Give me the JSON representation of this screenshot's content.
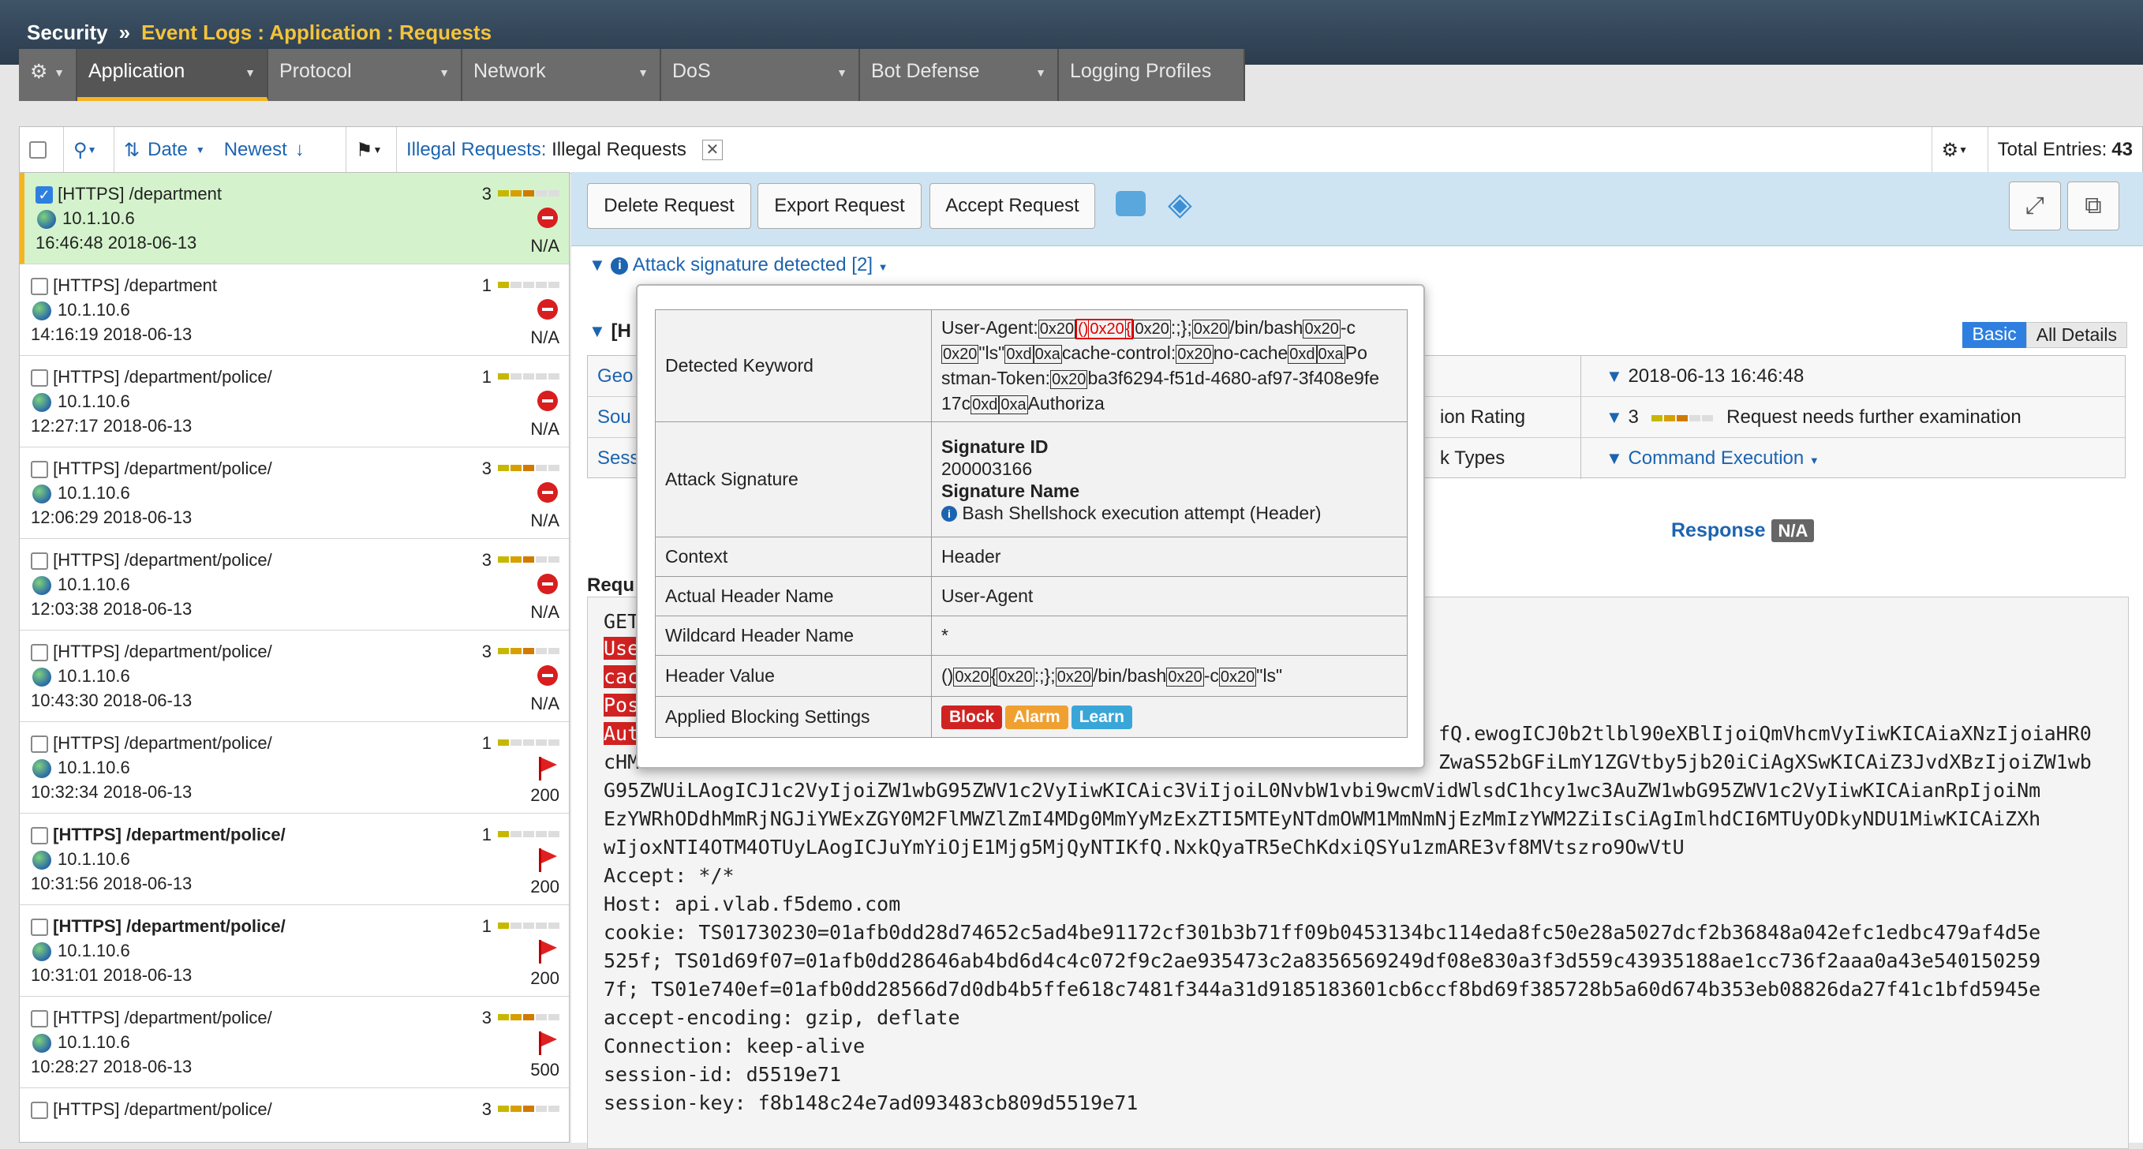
{
  "breadcrumb": {
    "root": "Security",
    "separator": "»",
    "path": "Event Logs : Application : Requests"
  },
  "tabs": [
    {
      "label": "Application"
    },
    {
      "label": "Protocol"
    },
    {
      "label": "Network"
    },
    {
      "label": "DoS"
    },
    {
      "label": "Bot Defense"
    },
    {
      "label": "Logging Profiles"
    }
  ],
  "toolbar": {
    "sort_label": "Date",
    "order_label": "Newest",
    "filter_key": "Illegal Requests:",
    "filter_value": "Illegal Requests",
    "total_label": "Total Entries:",
    "total_value": "43"
  },
  "colors": {
    "accent": "#f3b524",
    "link": "#1c64b0",
    "selected_row": "#d4f3cc",
    "block": "#d12222",
    "alarm": "#f0a030",
    "learn": "#3aa6d8"
  },
  "requests": [
    {
      "url": "[HTTPS] /department",
      "ip": "10.1.10.6",
      "time": "16:46:48 2018-06-13",
      "rating": "3",
      "code": "N/A",
      "status": "blocked",
      "selected": true,
      "bold": false
    },
    {
      "url": "[HTTPS] /department",
      "ip": "10.1.10.6",
      "time": "14:16:19 2018-06-13",
      "rating": "1",
      "code": "N/A",
      "status": "blocked",
      "selected": false,
      "bold": false
    },
    {
      "url": "[HTTPS] /department/police/",
      "ip": "10.1.10.6",
      "time": "12:27:17 2018-06-13",
      "rating": "1",
      "code": "N/A",
      "status": "blocked",
      "selected": false,
      "bold": false
    },
    {
      "url": "[HTTPS] /department/police/",
      "ip": "10.1.10.6",
      "time": "12:06:29 2018-06-13",
      "rating": "3",
      "code": "N/A",
      "status": "blocked",
      "selected": false,
      "bold": false
    },
    {
      "url": "[HTTPS] /department/police/",
      "ip": "10.1.10.6",
      "time": "12:03:38 2018-06-13",
      "rating": "3",
      "code": "N/A",
      "status": "blocked",
      "selected": false,
      "bold": false
    },
    {
      "url": "[HTTPS] /department/police/",
      "ip": "10.1.10.6",
      "time": "10:43:30 2018-06-13",
      "rating": "3",
      "code": "N/A",
      "status": "blocked",
      "selected": false,
      "bold": false
    },
    {
      "url": "[HTTPS] /department/police/",
      "ip": "10.1.10.6",
      "time": "10:32:34 2018-06-13",
      "rating": "1",
      "code": "200",
      "status": "flagged",
      "selected": false,
      "bold": false
    },
    {
      "url": "[HTTPS] /department/police/",
      "ip": "10.1.10.6",
      "time": "10:31:56 2018-06-13",
      "rating": "1",
      "code": "200",
      "status": "flagged",
      "selected": false,
      "bold": true
    },
    {
      "url": "[HTTPS] /department/police/",
      "ip": "10.1.10.6",
      "time": "10:31:01 2018-06-13",
      "rating": "1",
      "code": "200",
      "status": "flagged",
      "selected": false,
      "bold": true
    },
    {
      "url": "[HTTPS] /department/police/",
      "ip": "10.1.10.6",
      "time": "10:28:27 2018-06-13",
      "rating": "3",
      "code": "500",
      "status": "flagged",
      "selected": false,
      "bold": false
    },
    {
      "url": "[HTTPS] /department/police/",
      "ip": "",
      "time": "",
      "rating": "3",
      "code": "",
      "status": "",
      "selected": false,
      "bold": false
    }
  ],
  "actions": {
    "delete": "Delete Request",
    "export": "Export Request",
    "accept": "Accept Request"
  },
  "attack_line": "Attack signature detected [2]",
  "view_toggle": {
    "basic": "Basic",
    "all": "All Details"
  },
  "details": {
    "left_labels": [
      "Geo",
      "Sou",
      "Sess"
    ],
    "prefix_partial": "[H",
    "mid_labels": [
      "",
      "ion Rating",
      "k Types"
    ],
    "date": "2018-06-13 16:46:48",
    "rating_value": "3",
    "rating_text": "Request needs further examination",
    "attack_type": "Command Execution"
  },
  "response": {
    "label": "Response",
    "value": "N/A"
  },
  "request_label": "Requ",
  "raw_request": {
    "line_get": "GET",
    "red_tags": [
      "Use",
      "cac",
      "Pos",
      "Aut"
    ],
    "token_tail": "fQ.ewogICJ0b2tlbl90eXBlIjoiQmVhcmVyIiwKICAiaXNzIjoiaHR0",
    "lines": [
      "cHM",
      "G95ZWUiLAogICJ1c2VyIjoiZW1wbG95ZWV1c2VyIiwKICAic3ViIjoiL0NvbW1vbi9wcmVidWlsdC1hcy1wc3AuZW1wbG95ZWV1c2VyIiwKICAianRpIjoiNm",
      "EzYWRhODdhMmRjNGJiYWExZGY0M2FlMWZlZmI4MDg0MmYyMzExZTI5MTEyNTdmOWM1MmNmNjEzMmIzYWM2ZiIsCiAgImlhdCI6MTUyODkyNDU1MiwKICAiZXh",
      "wIjoxNTI4OTM4OTUyLAogICJuYmYiOjE1Mjg5MjQyNTIKfQ.NxkQyaTR5eChKdxiQSYu1zmARE3vf8MVtszro9OwVtU",
      "Accept: */*",
      "Host: api.vlab.f5demo.com",
      "cookie: TS01730230=01afb0dd28d74652c5ad4be91172cf301b3b71ff09b0453134bc114eda8fc50e28a5027dcf2b36848a042efc1edbc479af4d5e",
      "525f; TS01d69f07=01afb0dd28646ab4bd6d4c4c072f9c2ae935473c2a8356569249df08e830a3f3d559c43935188ae1cc736f2aaa0a43e540150259",
      "7f; TS01e740ef=01afb0dd28566d7d0db4b5ffe618c7481f344a31d9185183601cb6ccf8bd69f385728b5a60d674b353eb08826da27f41c1bfd5945e",
      "accept-encoding: gzip, deflate",
      "Connection: keep-alive",
      "session-id: d5519e71",
      "session-key: f8b148c24e7ad093483cb809d5519e71"
    ],
    "line2_tail": "ZwaS52bGFiLmY1ZGVtby5jb20iCiAgXSwKICAiZ3JvdXBzIjoiZW1wb"
  },
  "popup": {
    "detected_keyword_label": "Detected Keyword",
    "kw_ua": "User-Agent:",
    "kw_tokens": {
      "t1": "0x20",
      "t2": "()",
      "t3": "0x20",
      "t4": "{",
      "t5": "0x20",
      "t6": ":;};",
      "t7": "0x20",
      "t8": "/bin/bash",
      "t9": "0x20",
      "t10": "-c",
      "t11": "0x20",
      "t12": "\"ls\"",
      "t13": "0xd",
      "t14": "0xa",
      "t15": "cache-control:",
      "t16": "0x20",
      "t17": "no-cache",
      "t18": "0xd",
      "t19": "0xa",
      "t20": "Po",
      "t21": "stman-Token:",
      "t22": "0x20",
      "t23": "ba3f6294-f51d-4680-af97-3f408e9fe",
      "t24": "17c",
      "t25": "0xd",
      "t26": "0xa",
      "t27": "Authoriza"
    },
    "attack_signature_label": "Attack Signature",
    "sig_id_label": "Signature ID",
    "sig_id": "200003166",
    "sig_name_label": "Signature Name",
    "sig_name": "Bash Shellshock execution attempt (Header)",
    "context_label": "Context",
    "context": "Header",
    "actual_header_label": "Actual Header Name",
    "actual_header": "User-Agent",
    "wildcard_label": "Wildcard Header Name",
    "wildcard": "*",
    "header_value_label": "Header Value",
    "hv_tokens": {
      "a": "()",
      "b": "0x20",
      "c": "{",
      "d": "0x20",
      "e": ":;};",
      "f": "0x20",
      "g": "/bin/bash",
      "h": "0x20",
      "i": "-c",
      "j": "0x20",
      "k": "\"ls\""
    },
    "blocking_label": "Applied Blocking Settings",
    "blocking": [
      "Block",
      "Alarm",
      "Learn"
    ]
  }
}
